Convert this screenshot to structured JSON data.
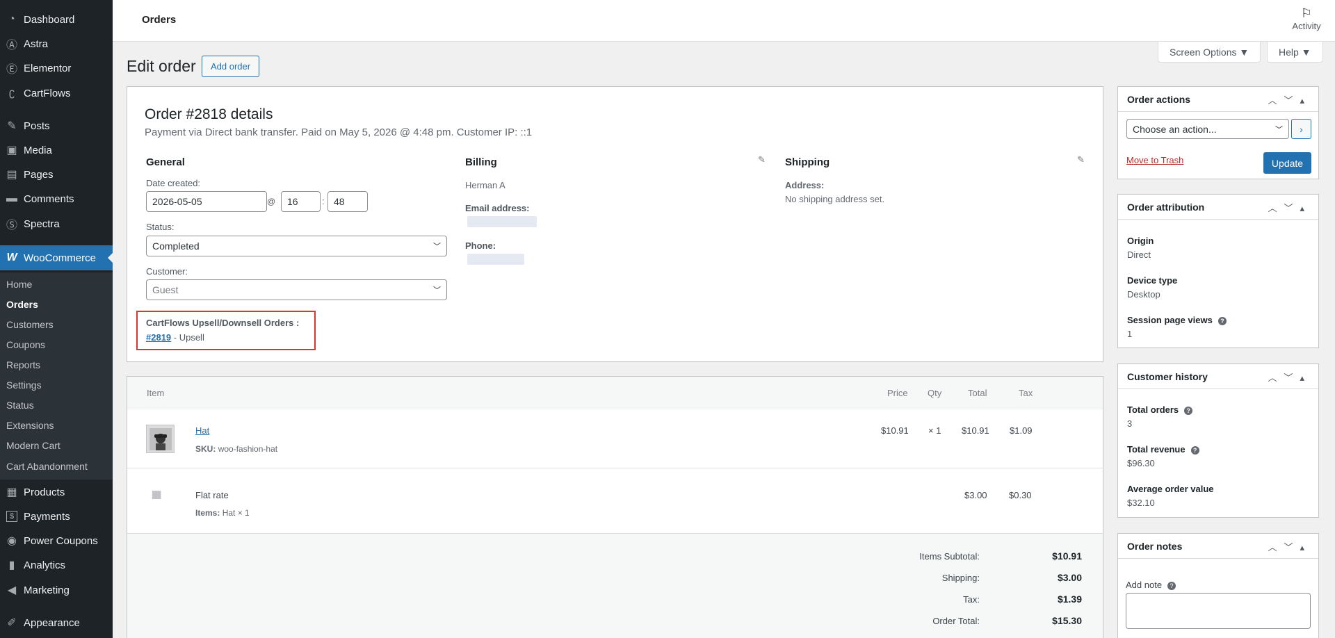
{
  "sidebar": {
    "items": [
      {
        "label": "Dashboard",
        "icon": "dashboard-icon",
        "glyph": "◔"
      },
      {
        "label": "Astra",
        "icon": "astra-icon",
        "glyph": "Ⓐ"
      },
      {
        "label": "Elementor",
        "icon": "elementor-icon",
        "glyph": "Ⓔ"
      },
      {
        "label": "CartFlows",
        "icon": "cartflows-icon",
        "glyph": "ʗ"
      },
      {
        "label": "Posts",
        "icon": "pin-icon",
        "glyph": "✎"
      },
      {
        "label": "Media",
        "icon": "media-icon",
        "glyph": "▣"
      },
      {
        "label": "Pages",
        "icon": "pages-icon",
        "glyph": "▤"
      },
      {
        "label": "Comments",
        "icon": "comments-icon",
        "glyph": "▬"
      },
      {
        "label": "Spectra",
        "icon": "spectra-icon",
        "glyph": "Ⓢ"
      },
      {
        "label": "WooCommerce",
        "icon": "woocommerce-icon",
        "glyph": "W"
      },
      {
        "label": "Products",
        "icon": "products-icon",
        "glyph": "▦"
      },
      {
        "label": "Payments",
        "icon": "payments-icon",
        "glyph": "$"
      },
      {
        "label": "Power Coupons",
        "icon": "power-coupons-icon",
        "glyph": "◉"
      },
      {
        "label": "Analytics",
        "icon": "analytics-icon",
        "glyph": "▮"
      },
      {
        "label": "Marketing",
        "icon": "marketing-icon",
        "glyph": "◀"
      },
      {
        "label": "Appearance",
        "icon": "appearance-icon",
        "glyph": "✐"
      }
    ],
    "submenu": [
      "Home",
      "Orders",
      "Customers",
      "Coupons",
      "Reports",
      "Settings",
      "Status",
      "Extensions",
      "Modern Cart",
      "Cart Abandonment"
    ]
  },
  "topbar": {
    "title": "Orders",
    "activity_label": "Activity"
  },
  "screen_options_label": "Screen Options ▼",
  "help_label": "Help ▼",
  "page_title": "Edit order",
  "add_order_label": "Add order",
  "order": {
    "title": "Order #2818 details",
    "subtitle": "Payment via Direct bank transfer. Paid on May 5, 2026 @ 4:48 pm. Customer IP: ::1",
    "general": {
      "heading": "General",
      "date_label": "Date created:",
      "date_value": "2026-05-05",
      "at": "@",
      "hour": "16",
      "colon": ":",
      "minute": "48",
      "status_label": "Status:",
      "status_value": "Completed",
      "customer_label": "Customer:",
      "customer_placeholder": "Guest"
    },
    "cartflows": {
      "label": "CartFlows Upsell/Downsell Orders :",
      "order_link": "#2819",
      "suffix": " - Upsell"
    },
    "billing": {
      "heading": "Billing",
      "name": "Herman A",
      "email_label": "Email address:",
      "phone_label": "Phone:"
    },
    "shipping": {
      "heading": "Shipping",
      "address_label": "Address:",
      "address_value": "No shipping address set."
    }
  },
  "items": {
    "headers": {
      "item": "Item",
      "price": "Price",
      "qty": "Qty",
      "total": "Total",
      "tax": "Tax"
    },
    "product": {
      "name": "Hat",
      "sku_label": "SKU:",
      "sku": "woo-fashion-hat",
      "price": "$10.91",
      "qty": "× 1",
      "total": "$10.91",
      "tax": "$1.09"
    },
    "shipping_line": {
      "name": "Flat rate",
      "items_label": "Items:",
      "items_value": "Hat × 1",
      "total": "$3.00",
      "tax": "$0.30"
    },
    "totals": [
      {
        "label": "Items Subtotal:",
        "value": "$10.91"
      },
      {
        "label": "Shipping:",
        "value": "$3.00"
      },
      {
        "label": "Tax:",
        "value": "$1.39"
      },
      {
        "label": "Order Total:",
        "value": "$15.30"
      }
    ]
  },
  "order_actions": {
    "title": "Order actions",
    "select_value": "Choose an action...",
    "trash_label": "Move to Trash",
    "update_label": "Update"
  },
  "order_attribution": {
    "title": "Order attribution",
    "fields": [
      {
        "label": "Origin",
        "value": "Direct"
      },
      {
        "label": "Device type",
        "value": "Desktop"
      },
      {
        "label": "Session page views",
        "value": "1"
      }
    ]
  },
  "customer_history": {
    "title": "Customer history",
    "fields": [
      {
        "label": "Total orders",
        "value": "3"
      },
      {
        "label": "Total revenue",
        "value": "$96.30"
      },
      {
        "label": "Average order value",
        "value": "$32.10"
      }
    ]
  },
  "order_notes": {
    "title": "Order notes",
    "add_note_label": "Add note"
  },
  "colors": {
    "sidebar_bg": "#1d2327",
    "accent": "#2271b1",
    "highlight_border": "#d63638"
  }
}
